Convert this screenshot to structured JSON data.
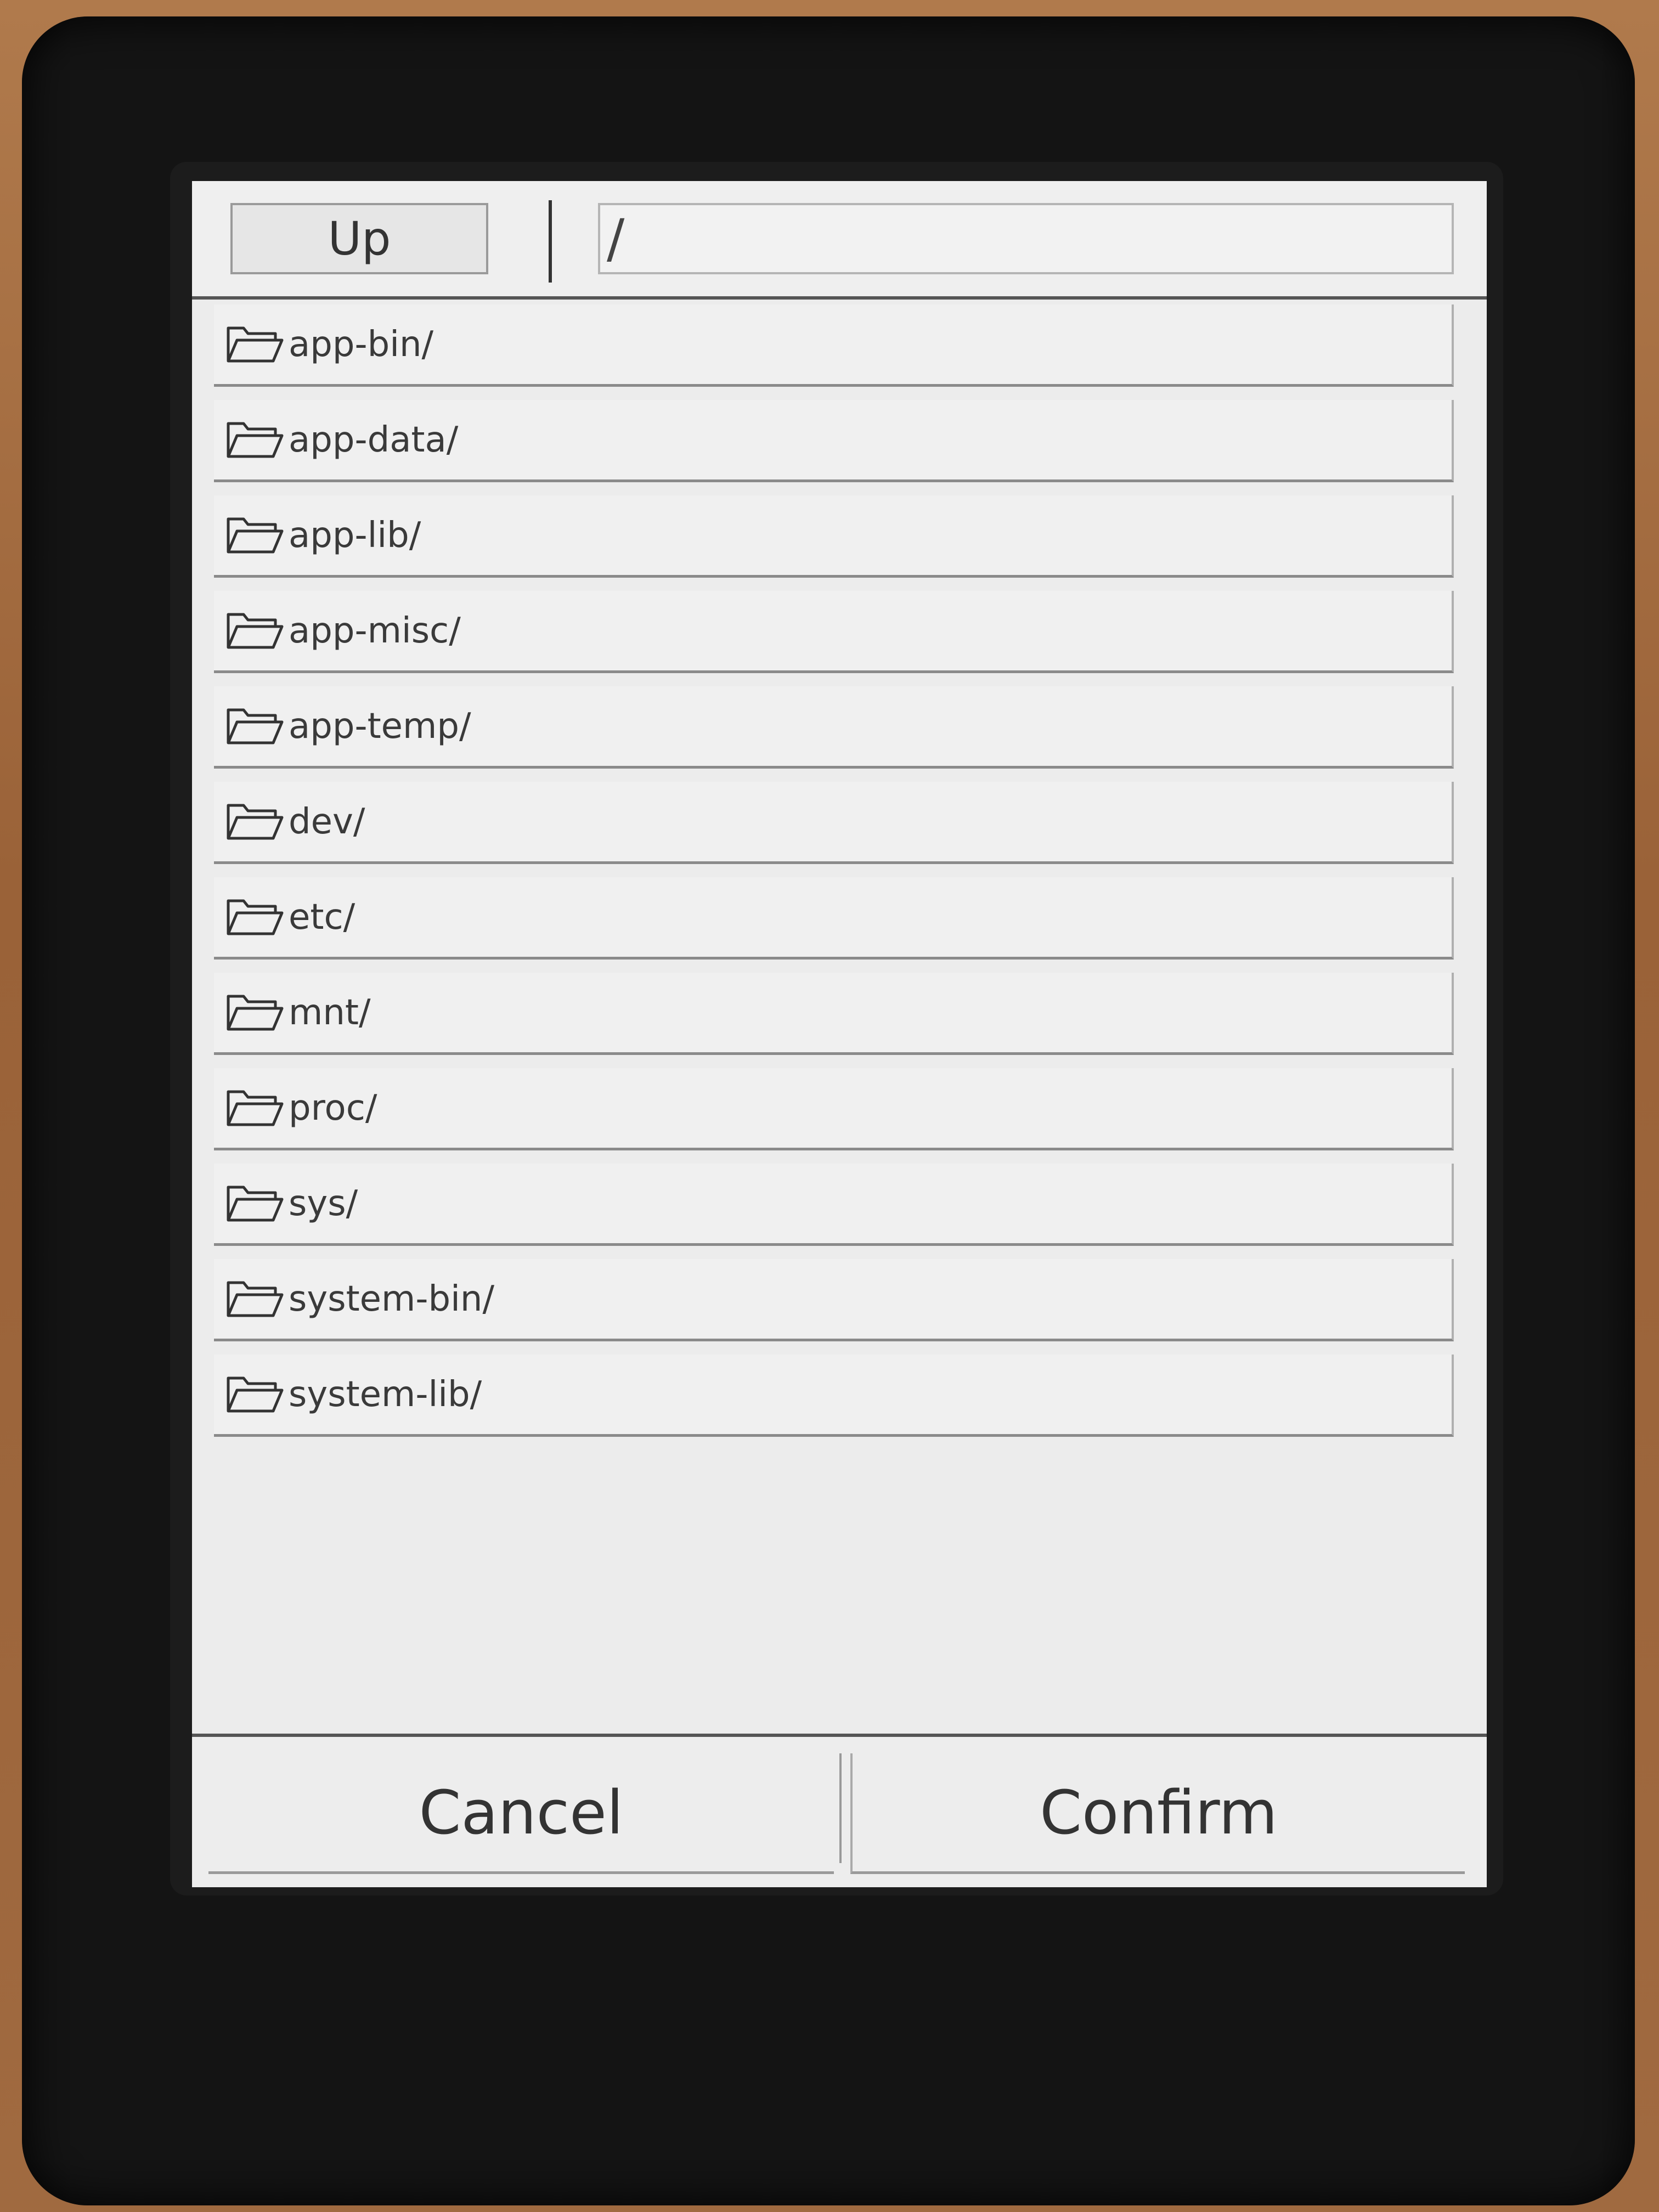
{
  "header": {
    "up_label": "Up",
    "path_value": "/"
  },
  "items": [
    {
      "label": "app-bin/",
      "icon": "folder-icon"
    },
    {
      "label": "app-data/",
      "icon": "folder-icon"
    },
    {
      "label": "app-lib/",
      "icon": "folder-icon"
    },
    {
      "label": "app-misc/",
      "icon": "folder-icon"
    },
    {
      "label": "app-temp/",
      "icon": "folder-icon"
    },
    {
      "label": "dev/",
      "icon": "folder-icon"
    },
    {
      "label": "etc/",
      "icon": "folder-icon"
    },
    {
      "label": "mnt/",
      "icon": "folder-icon"
    },
    {
      "label": "proc/",
      "icon": "folder-icon"
    },
    {
      "label": "sys/",
      "icon": "folder-icon"
    },
    {
      "label": "system-bin/",
      "icon": "folder-icon"
    },
    {
      "label": "system-lib/",
      "icon": "folder-icon"
    }
  ],
  "footer": {
    "cancel_label": "Cancel",
    "confirm_label": "Confirm"
  }
}
